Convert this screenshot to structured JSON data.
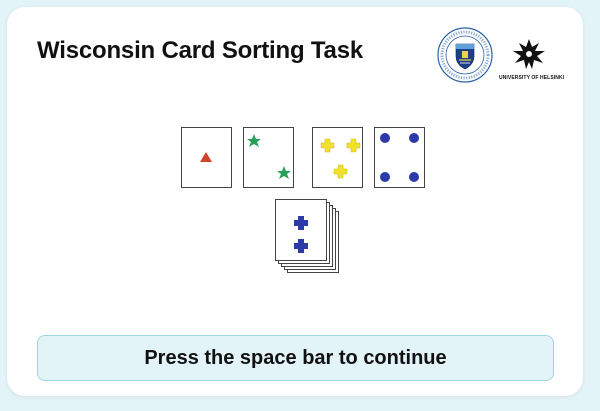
{
  "header": {
    "title": "Wisconsin Card Sorting Task"
  },
  "logos": {
    "uct_ring_text": "University of Cape Town · Iyunivesithi yaseKapa · Universiteit van Kaapstad",
    "helsinki_label": "UNIVERSITY OF HELSINKI"
  },
  "task": {
    "key_cards": [
      {
        "shape": "triangle",
        "color": "#d2452b",
        "count": 1
      },
      {
        "shape": "star",
        "color": "#27a05a",
        "count": 2
      },
      {
        "shape": "cross",
        "color": "#f2e12a",
        "count": 3
      },
      {
        "shape": "circle",
        "color": "#2b3aa8",
        "count": 4
      }
    ],
    "response_card": {
      "shape": "cross",
      "color": "#2b3aa8",
      "count": 2
    },
    "deck_stack_count": 5
  },
  "prompt": {
    "text": "Press the space bar to continue"
  },
  "colors": {
    "page_background": "#e3f4f8",
    "panel_background": "#ffffff",
    "prompt_background": "#e3f4f8",
    "prompt_border": "#9fd4e4"
  }
}
